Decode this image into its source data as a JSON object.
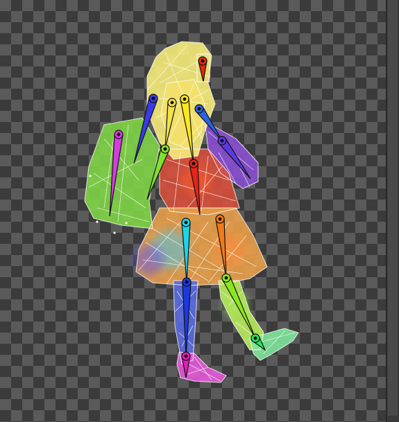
{
  "colors": {
    "checker_dark": "#3b3b3b",
    "checker_light": "#5a5a5a",
    "wire": "#ffffff",
    "joint": "#0a0a0a",
    "handle_box": "#ffffff"
  },
  "canvas": {
    "view_mode": "skeleton-rig-weight-view",
    "background": "transparency-checkerboard"
  },
  "character_parts": [
    {
      "name": "hair",
      "color": "#f6ec7a"
    },
    {
      "name": "head",
      "color": "#f3e06a"
    },
    {
      "name": "left-sleeve",
      "color": "#7fd447"
    },
    {
      "name": "torso",
      "color": "#d64f3c"
    },
    {
      "name": "right-sleeve",
      "color": "#8a4fd0"
    },
    {
      "name": "skirt",
      "color": "#e8a04a"
    },
    {
      "name": "left-leg",
      "color": "#5a6ae0"
    },
    {
      "name": "right-leg",
      "color": "#b8ea5a"
    },
    {
      "name": "left-foot",
      "color": "#e35ad8"
    },
    {
      "name": "right-foot",
      "color": "#7ee59a"
    }
  ],
  "bones": [
    {
      "name": "head",
      "color": "#e02a10"
    },
    {
      "name": "neck",
      "color": "#3bd14a"
    },
    {
      "name": "left-upper-arm",
      "color": "#f3e24a"
    },
    {
      "name": "left-forearm",
      "color": "#7fe12c"
    },
    {
      "name": "right-upper-arm",
      "color": "#2a62e0"
    },
    {
      "name": "right-forearm",
      "color": "#5a3ae0"
    },
    {
      "name": "spine-upper",
      "color": "#ffe81a"
    },
    {
      "name": "spine-lower",
      "color": "#e8231a"
    },
    {
      "name": "hair-back-left",
      "color": "#d63ae0"
    },
    {
      "name": "hair-back-right",
      "color": "#3a3ae8"
    },
    {
      "name": "left-thigh",
      "color": "#1ad6e8"
    },
    {
      "name": "left-shin",
      "color": "#1a3ae0"
    },
    {
      "name": "left-foot",
      "color": "#e81ab8"
    },
    {
      "name": "right-thigh",
      "color": "#f07a1a"
    },
    {
      "name": "right-shin",
      "color": "#8ae81a"
    },
    {
      "name": "right-foot",
      "color": "#2ae05a"
    }
  ]
}
